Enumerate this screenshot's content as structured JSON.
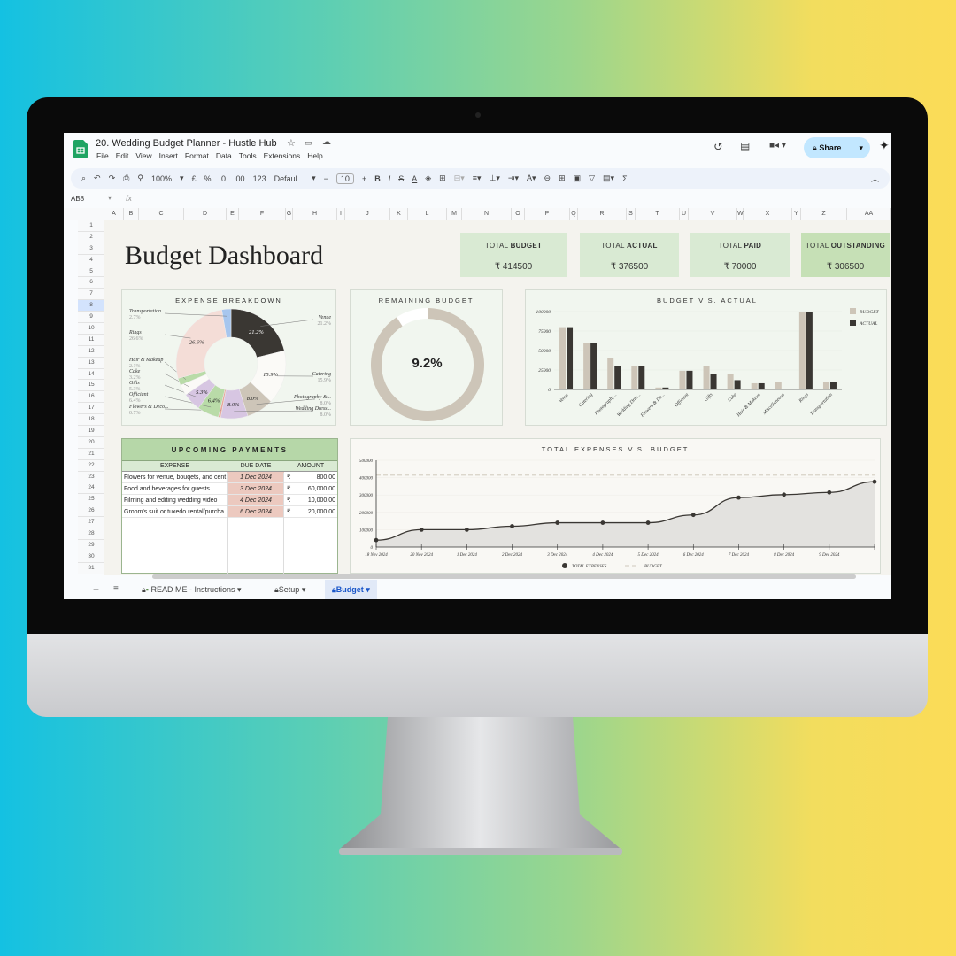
{
  "app": {
    "title": "20. Wedding Budget Planner - Hustle Hub",
    "menu": [
      "File",
      "Edit",
      "View",
      "Insert",
      "Format",
      "Data",
      "Tools",
      "Extensions",
      "Help"
    ],
    "share_label": "Share",
    "cell_ref": "AB8",
    "fx": "fx"
  },
  "toolbar": {
    "zoom": "100%",
    "currency": "£",
    "percent": "%",
    "dec_less": ".0",
    "dec_more": ".00",
    "number_format": "123",
    "font": "Defaul...",
    "font_size": "10"
  },
  "columns": [
    "A",
    "B",
    "C",
    "D",
    "E",
    "F",
    "G",
    "H",
    "I",
    "J",
    "K",
    "L",
    "M",
    "N",
    "O",
    "P",
    "Q",
    "R",
    "S",
    "T",
    "U",
    "V",
    "W",
    "X",
    "Y",
    "Z",
    "AA"
  ],
  "rows": [
    "1",
    "2",
    "3",
    "4",
    "5",
    "6",
    "7",
    "8",
    "9",
    "10",
    "11",
    "12",
    "13",
    "14",
    "15",
    "16",
    "17",
    "18",
    "19",
    "20",
    "21",
    "22",
    "23",
    "24",
    "25",
    "26",
    "27",
    "28",
    "29",
    "30",
    "31"
  ],
  "dashboard": {
    "title": "Budget Dashboard",
    "kpis": [
      {
        "pre": "TOTAL ",
        "bold": "BUDGET",
        "value": "₹ 414500"
      },
      {
        "pre": "TOTAL ",
        "bold": "ACTUAL",
        "value": "₹ 376500"
      },
      {
        "pre": "TOTAL ",
        "bold": "PAID",
        "value": "₹ 70000"
      },
      {
        "pre": "TOTAL ",
        "bold": "OUTSTANDING",
        "value": "₹ 306500"
      }
    ]
  },
  "colors": {
    "dark": "#3a3733",
    "tan": "#cdc5b8",
    "green_header": "#b6d7a8",
    "green_light": "#d9ead3",
    "due_bg": "#ecc9bf"
  },
  "payments": {
    "title": "UPCOMING PAYMENTS",
    "headers": [
      "EXPENSE",
      "DUE DATE",
      "AMOUNT"
    ],
    "currency": "₹",
    "rows": [
      {
        "expense": "Flowers for venue, bouqets, and cent",
        "due": "1 Dec 2024",
        "amount": "800.00"
      },
      {
        "expense": "Food and beverages for guests",
        "due": "3 Dec 2024",
        "amount": "60,000.00"
      },
      {
        "expense": "Filming and editing wedding video",
        "due": "4 Dec 2024",
        "amount": "10,000.00"
      },
      {
        "expense": "Groom's suit or tuxedo rental/purcha",
        "due": "6 Dec 2024",
        "amount": "20,000.00"
      }
    ]
  },
  "sheet_tabs": [
    {
      "label": "READ ME - Instructions"
    },
    {
      "label": "Setup"
    },
    {
      "label": "Budget",
      "active": true
    }
  ],
  "chart_data": [
    {
      "type": "pie",
      "title": "EXPENSE BREAKDOWN",
      "donut": true,
      "slices": [
        {
          "name": "Venue",
          "value": 21.2,
          "label": "21.2%",
          "color": "#3a3733"
        },
        {
          "name": "Catering",
          "value": 15.9,
          "label": "15.9%",
          "color": "#fbfaf7"
        },
        {
          "name": "Photography &...",
          "value": 8.0,
          "label": "8.0%",
          "color": "#cdc5b8"
        },
        {
          "name": "Wedding Dress...",
          "value": 8.0,
          "label": "8.0%",
          "color": "#d7c6e2"
        },
        {
          "name": "Flowers & Deco...",
          "value": 0.7,
          "label": "0.7%",
          "color": "#e8a89a"
        },
        {
          "name": "Officiant",
          "value": 6.4,
          "label": "6.4%",
          "color": "#b9dba8"
        },
        {
          "name": "Gifts",
          "value": 5.3,
          "label": "5.3%",
          "color": "#d7c6e2"
        },
        {
          "name": "Cake",
          "value": 3.2,
          "label": "3.2%",
          "color": "#fbfaf7"
        },
        {
          "name": "Hair & Makeup",
          "value": 2.1,
          "label": "2.1%",
          "color": "#b9dba8"
        },
        {
          "name": "Rings",
          "value": 26.6,
          "label": "26.6%",
          "color": "#f4ddd7"
        },
        {
          "name": "Transportation",
          "value": 2.7,
          "label": "2.7%",
          "color": "#a7c6ee"
        }
      ]
    },
    {
      "type": "pie",
      "title": "REMAINING BUDGET",
      "donut": true,
      "value_label": "9.2%",
      "slices": [
        {
          "name": "remaining",
          "value": 9.2,
          "color": "#ffffff"
        },
        {
          "name": "spent",
          "value": 90.8,
          "color": "#cdc5b8"
        }
      ]
    },
    {
      "type": "bar",
      "title": "BUDGET V.S. ACTUAL",
      "legend": "right",
      "ylim": [
        0,
        100000
      ],
      "yticks": [
        0,
        25000,
        50000,
        75000,
        100000
      ],
      "categories": [
        "Venue",
        "Catering",
        "Photography...",
        "Wedding Dres...",
        "Flowers & De...",
        "Officiant",
        "Gifts",
        "Cake",
        "Hair & Makeup",
        "Miscellaneous",
        "Rings",
        "Transportation"
      ],
      "series": [
        {
          "name": "BUDGET",
          "color": "#cdc5b8",
          "values": [
            80000,
            60000,
            40000,
            30000,
            2500,
            24000,
            30000,
            20000,
            8000,
            10000,
            100000,
            10000
          ]
        },
        {
          "name": "ACTUAL",
          "color": "#3a3733",
          "values": [
            80000,
            60000,
            30000,
            30000,
            2500,
            24000,
            20000,
            12000,
            8000,
            0,
            100000,
            10000
          ]
        }
      ]
    },
    {
      "type": "area",
      "title": "TOTAL EXPENSES V.S. BUDGET",
      "legend": "bottom",
      "ylim": [
        0,
        500000
      ],
      "yticks": [
        0,
        100000,
        200000,
        300000,
        400000,
        500000
      ],
      "x": [
        "18 Nov 2024",
        "20 Nov 2024",
        "1 Dec 2024",
        "2 Dec 2024",
        "3 Dec 2024",
        "4 Dec 2024",
        "5 Dec 2024",
        "6 Dec 2024",
        "7 Dec 2024",
        "8 Dec 2024",
        "9 Dec 2024",
        ""
      ],
      "series": [
        {
          "name": "TOTAL EXPENSES",
          "color": "#3a3733",
          "values": [
            40000,
            100000,
            100000,
            120000,
            140000,
            140000,
            140000,
            185000,
            285000,
            302000,
            315000,
            376500
          ]
        },
        {
          "name": "BUDGET",
          "color": "#d8d2c6",
          "dashed": true,
          "values": [
            414500,
            414500,
            414500,
            414500,
            414500,
            414500,
            414500,
            414500,
            414500,
            414500,
            414500,
            414500
          ]
        }
      ]
    }
  ]
}
